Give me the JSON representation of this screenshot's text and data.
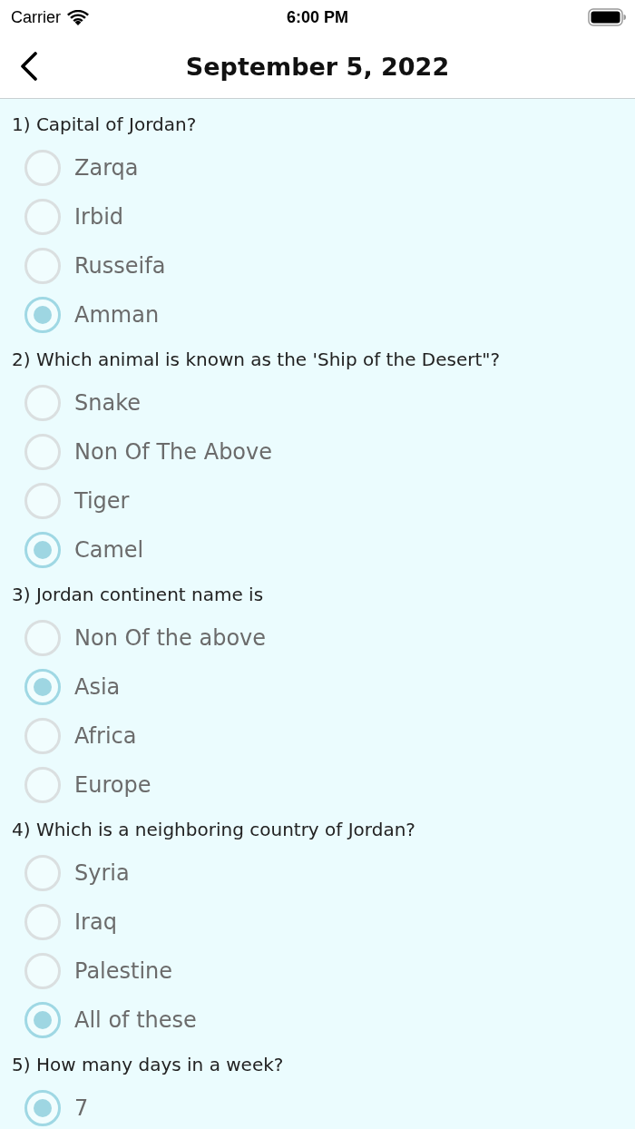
{
  "status_bar": {
    "carrier": "Carrier",
    "time": "6:00 PM"
  },
  "nav_bar": {
    "title": "September 5, 2022"
  },
  "questions": [
    {
      "text": "1) Capital of Jordan?",
      "options": [
        {
          "label": "Zarqa",
          "selected": false
        },
        {
          "label": "Irbid",
          "selected": false
        },
        {
          "label": "Russeifa",
          "selected": false
        },
        {
          "label": "Amman",
          "selected": true
        }
      ]
    },
    {
      "text": "2) Which animal is known as the 'Ship of the Desert\"?",
      "options": [
        {
          "label": "Snake",
          "selected": false
        },
        {
          "label": "Non Of The Above",
          "selected": false
        },
        {
          "label": "Tiger",
          "selected": false
        },
        {
          "label": "Camel",
          "selected": true
        }
      ]
    },
    {
      "text": "3) Jordan continent name is",
      "options": [
        {
          "label": "Non Of the above",
          "selected": false
        },
        {
          "label": "Asia",
          "selected": true
        },
        {
          "label": "Africa",
          "selected": false
        },
        {
          "label": "Europe",
          "selected": false
        }
      ]
    },
    {
      "text": "4) Which is a neighboring country of Jordan?",
      "options": [
        {
          "label": "Syria",
          "selected": false
        },
        {
          "label": "Iraq",
          "selected": false
        },
        {
          "label": "Palestine",
          "selected": false
        },
        {
          "label": "All of these",
          "selected": true
        }
      ]
    },
    {
      "text": "5) How many days in a week?",
      "options": [
        {
          "label": "7",
          "selected": true
        }
      ]
    }
  ]
}
